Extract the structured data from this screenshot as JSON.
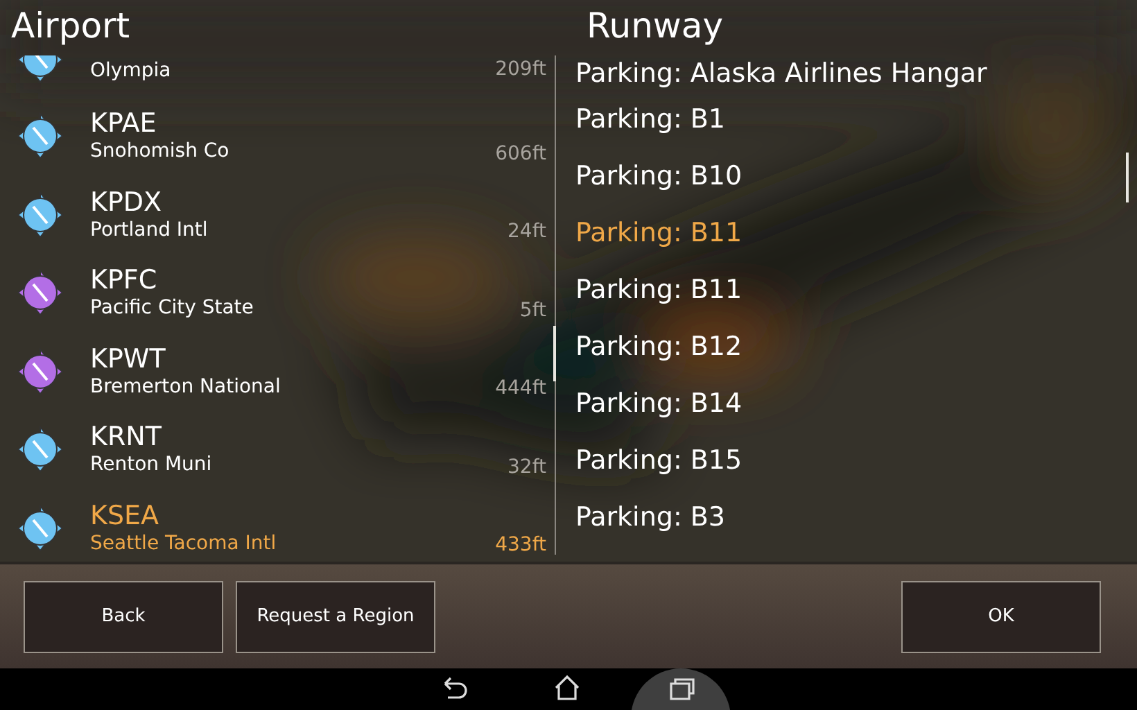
{
  "airport_panel": {
    "title": "Airport",
    "airports": [
      {
        "name": "Olympia",
        "elevation": "209ft",
        "color": "#6ec3f2",
        "selected": false
      },
      {
        "code": "KPAE",
        "name": "Snohomish Co",
        "elevation": "606ft",
        "color": "#6ec3f2",
        "selected": false
      },
      {
        "code": "KPDX",
        "name": "Portland Intl",
        "elevation": "24ft",
        "color": "#6ec3f2",
        "selected": false
      },
      {
        "code": "KPFC",
        "name": "Pacific City State",
        "elevation": "5ft",
        "color": "#b36ee6",
        "selected": false
      },
      {
        "code": "KPWT",
        "name": "Bremerton National",
        "elevation": "444ft",
        "color": "#b36ee6",
        "selected": false
      },
      {
        "code": "KRNT",
        "name": "Renton Muni",
        "elevation": "32ft",
        "color": "#6ec3f2",
        "selected": false
      },
      {
        "code": "KSEA",
        "name": "Seattle Tacoma Intl",
        "elevation": "433ft",
        "color": "#6ec3f2",
        "selected": true
      }
    ]
  },
  "runway_panel": {
    "title": "Runway",
    "runways": [
      {
        "label": "Parking: Alaska Airlines Hangar",
        "selected": false
      },
      {
        "label": "Parking: B1",
        "selected": false
      },
      {
        "label": "Parking: B10",
        "selected": false
      },
      {
        "label": "Parking: B11",
        "selected": true
      },
      {
        "label": "Parking: B11",
        "selected": false
      },
      {
        "label": "Parking: B12",
        "selected": false
      },
      {
        "label": "Parking: B14",
        "selected": false
      },
      {
        "label": "Parking: B15",
        "selected": false
      },
      {
        "label": "Parking: B3",
        "selected": false
      }
    ]
  },
  "buttons": [
    "Back",
    "Request a Region",
    "OK"
  ]
}
